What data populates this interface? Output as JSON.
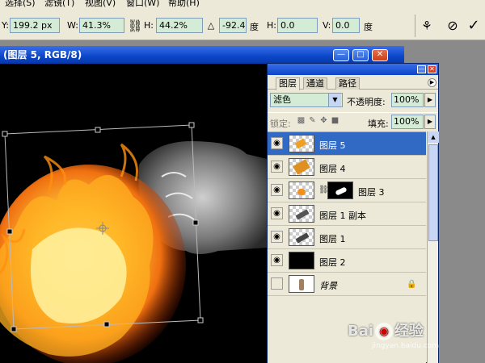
{
  "menu": {
    "items": [
      "选择(S)",
      "滤镜(T)",
      "视图(V)",
      "窗口(W)",
      "帮助(H)"
    ]
  },
  "options_bar": {
    "y_label": "Y:",
    "y_value": "199.2 px",
    "w_label": "W:",
    "w_value": "41.3%",
    "h_label": "H:",
    "h_value": "44.2%",
    "angle_value": "-92.4",
    "angle_unit": "度",
    "hskew_label": "H:",
    "hskew_value": "0.0",
    "vskew_label": "V:",
    "vskew_value": "0.0",
    "skew_unit": "度",
    "icons": [
      "link-icon",
      "angle-icon",
      "warp-icon",
      "cancel-icon",
      "commit-icon"
    ]
  },
  "document": {
    "title": "(图层 5, RGB/8)"
  },
  "layers_panel": {
    "tabs": [
      "图层",
      "通道",
      "路径"
    ],
    "blend_mode": "滤色",
    "opacity_label": "不透明度:",
    "opacity_value": "100%",
    "lock_label": "锁定:",
    "fill_label": "填充:",
    "fill_value": "100%",
    "layers": [
      {
        "name": "图层 5",
        "selected": true,
        "visible": true
      },
      {
        "name": "图层 4",
        "selected": false,
        "visible": true
      },
      {
        "name": "图层 3",
        "selected": false,
        "visible": true
      },
      {
        "name": "图层 1 副本",
        "selected": false,
        "visible": true
      },
      {
        "name": "图层 1",
        "selected": false,
        "visible": true
      },
      {
        "name": "图层 2",
        "selected": false,
        "visible": true
      },
      {
        "name": "背景",
        "selected": false,
        "visible": false
      }
    ]
  },
  "watermark": {
    "text_left": "Bai",
    "text_right": "经验",
    "url": "jingyan.baidu.com"
  },
  "colors": {
    "title_bar": "#0a46c8",
    "selection": "#316ac5",
    "field_bg": "#d4ecd5",
    "chrome": "#ece9d8"
  }
}
